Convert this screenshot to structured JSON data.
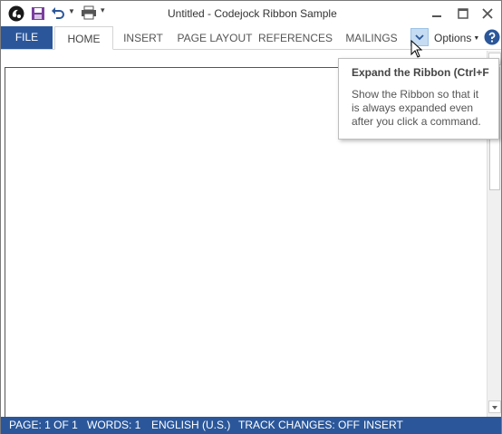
{
  "window": {
    "title": "Untitled - Codejock Ribbon Sample"
  },
  "quick_access": {
    "icons": [
      "app-logo-icon",
      "save-icon",
      "undo-icon",
      "dropdown-arrow-icon",
      "print-icon",
      "customize-toolbar-icon"
    ]
  },
  "ribbon": {
    "file_label": "FILE",
    "tabs": [
      {
        "label": "HOME"
      },
      {
        "label": "INSERT"
      },
      {
        "label": "PAGE LAYOUT"
      },
      {
        "label": "REFERENCES"
      },
      {
        "label": "MAILINGS"
      }
    ],
    "options_label": "Options"
  },
  "tooltip": {
    "title": "Expand the Ribbon (Ctrl+F",
    "body_lines": [
      "Show the Ribbon so that it",
      "is always expanded even",
      "after you click a command."
    ]
  },
  "statusbar": {
    "page": "PAGE: 1 OF 1",
    "words": "WORDS: 1",
    "language": "ENGLISH (U.S.)",
    "track_changes": "TRACK CHANGES: OFF",
    "mode": "INSERT"
  },
  "colors": {
    "accent": "#2b579a",
    "highlight": "#c5dcf2"
  }
}
